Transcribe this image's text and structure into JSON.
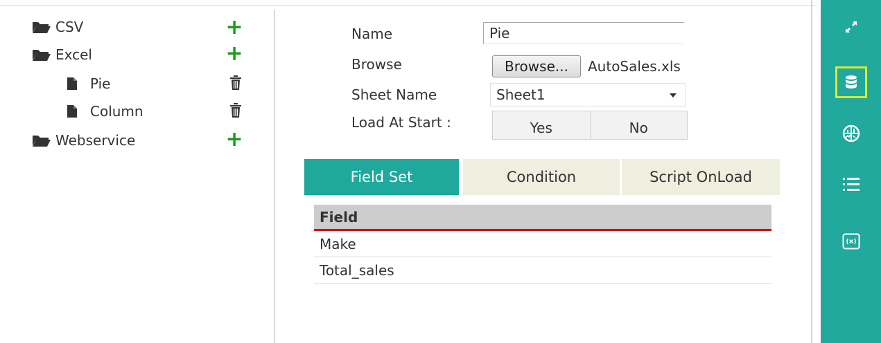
{
  "tree": {
    "items": [
      {
        "label": "CSV",
        "icon": "folder-open-icon",
        "action": "plus-icon"
      },
      {
        "label": "Excel",
        "icon": "folder-open-icon",
        "action": "plus-icon"
      },
      {
        "label": "Pie",
        "icon": "file-icon",
        "action": "trash-icon"
      },
      {
        "label": "Column",
        "icon": "file-icon",
        "action": "trash-icon"
      },
      {
        "label": "Webservice",
        "icon": "folder-open-icon",
        "action": "plus-icon"
      }
    ]
  },
  "form": {
    "name_label": "Name",
    "name_value": "Pie",
    "browse_label": "Browse",
    "browse_button": "Browse...",
    "file_name": "AutoSales.xls",
    "sheet_label": "Sheet Name",
    "sheet_value": "Sheet1",
    "load_label": "Load At Start :",
    "load_yes": "Yes",
    "load_no": "No"
  },
  "tabs": [
    {
      "label": "Field Set",
      "active": true
    },
    {
      "label": "Condition",
      "active": false
    },
    {
      "label": "Script OnLoad",
      "active": false
    }
  ],
  "grid": {
    "header": "Field",
    "rows": [
      "Make",
      "Total_sales"
    ]
  },
  "toolbar": {
    "items": [
      "expand-icon",
      "database-icon",
      "chart-wheel-icon",
      "list-icon",
      "function-icon"
    ],
    "selected": "database-icon"
  },
  "colors": {
    "accent": "#20a99c",
    "selected_border": "#d9ea31",
    "header_underline": "#cc1111",
    "add_green": "#1a9e1a"
  }
}
